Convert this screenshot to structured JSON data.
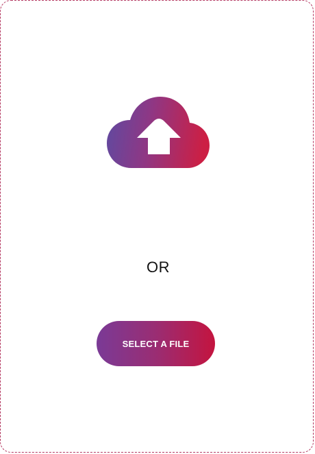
{
  "upload": {
    "icon": "cloud-upload-icon",
    "separator": "OR",
    "button_label": "SELECT A FILE"
  },
  "colors": {
    "border": "#b3365f",
    "gradient_start": "#6b4ba0",
    "gradient_mid": "#9a2d73",
    "gradient_end": "#c4143f"
  }
}
